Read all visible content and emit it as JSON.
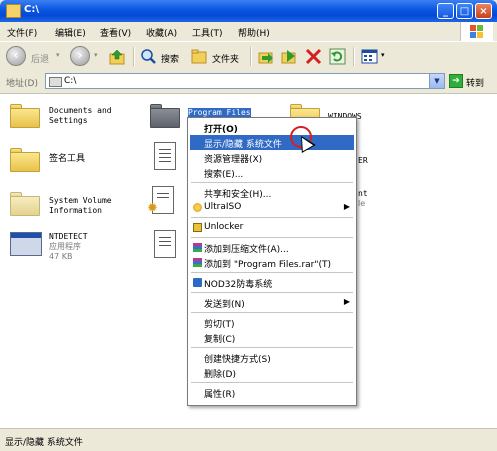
{
  "window": {
    "title": "C:\\"
  },
  "title_buttons": {
    "minimize": "_",
    "maximize": "□",
    "close": "×"
  },
  "menubar": [
    "文件(F)",
    "编辑(E)",
    "查看(V)",
    "收藏(A)",
    "工具(T)",
    "帮助(H)"
  ],
  "toolbar": {
    "back_label": "后退",
    "search_label": "搜索",
    "folders_label": "文件夹",
    "icons": [
      "back-icon",
      "forward-icon",
      "up-folder-icon",
      "search-icon",
      "folders-icon",
      "move-to-icon",
      "copy-to-icon",
      "delete-icon",
      "undo-icon",
      "views-icon"
    ]
  },
  "address": {
    "label": "地址(D)",
    "value": "C:\\",
    "go_label": "转到"
  },
  "items": [
    {
      "name": "Documents and\nSettings",
      "icon": "folder-icon",
      "selected": false
    },
    {
      "name": "Program Files",
      "icon": "folder-icon",
      "selected": true
    },
    {
      "name": "WINDOWS",
      "icon": "folder-icon",
      "selected": false
    },
    {
      "name": "签名工具",
      "icon": "folder-icon",
      "selected": false
    },
    {
      "name": "ER",
      "icon": "document-icon",
      "selected": false
    },
    {
      "name": "System Volume\nInformation",
      "icon": "folder-icon",
      "selected": false
    },
    {
      "name": "nt",
      "type": "le",
      "icon": "document-icon",
      "selected": false
    },
    {
      "name": "NTDETECT",
      "type": "应用程序",
      "size": "47 KB",
      "icon": "application-icon",
      "selected": false
    }
  ],
  "context_menu": {
    "items": [
      {
        "label": "打开(O)",
        "bold": true
      },
      {
        "label": "显示/隐藏 系统文件",
        "highlighted": true
      },
      {
        "label": "资源管理器(X)"
      },
      {
        "label": "搜索(E)..."
      },
      {
        "label": "共享和安全(H)..."
      },
      {
        "label": "UltraISO",
        "submenu": true,
        "icon": "ultraiso-icon"
      },
      {
        "label": "Unlocker",
        "icon": "unlocker-icon"
      },
      {
        "label": "添加到压缩文件(A)...",
        "icon": "winrar-icon"
      },
      {
        "label": "添加到 \"Program Files.rar\"(T)",
        "icon": "winrar-icon"
      },
      {
        "label": "NOD32防毒系统",
        "icon": "nod32-icon"
      },
      {
        "label": "发送到(N)",
        "submenu": true
      },
      {
        "label": "剪切(T)"
      },
      {
        "label": "复制(C)"
      },
      {
        "label": "创建快捷方式(S)"
      },
      {
        "label": "删除(D)"
      },
      {
        "label": "属性(R)"
      }
    ],
    "submenu_arrow": "▶"
  },
  "statusbar": {
    "text": "显示/隐藏 系统文件"
  },
  "colors": {
    "selection": "#316ac5",
    "content_bg": "#ffffff",
    "chrome": "#ece9d8"
  }
}
